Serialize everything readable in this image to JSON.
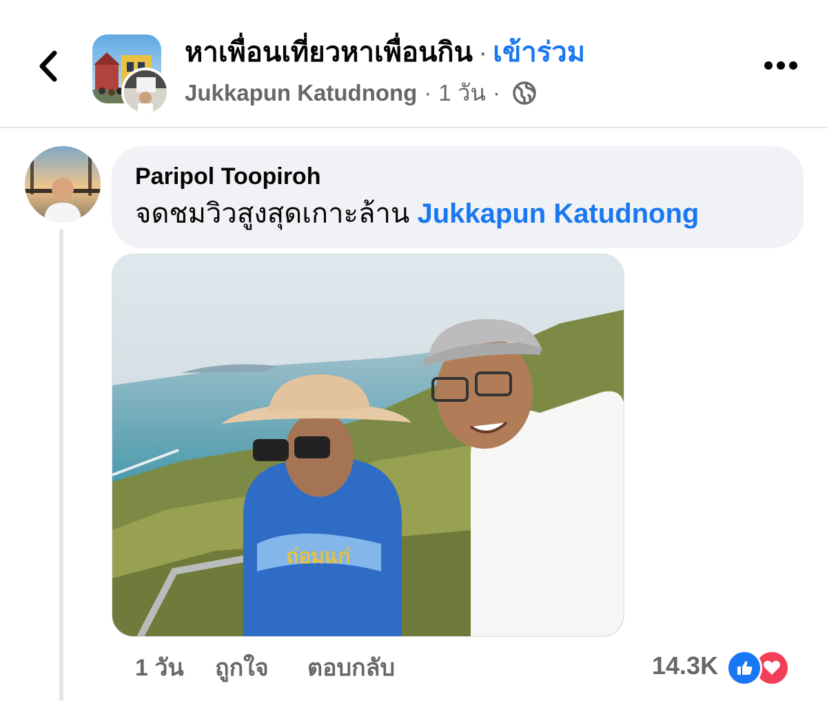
{
  "header": {
    "group_name": "หาเพื่อนเที่ยวหาเพื่อนกิน",
    "dot": "·",
    "join_label": "เข้าร่วม",
    "author": "Jukkapun Katudnong",
    "meta_sep": "·",
    "time": "1 วัน",
    "meta_sep2": "·",
    "privacy_icon": "globe-icon",
    "back_icon": "chevron-left-icon",
    "more_icon": "more-horizontal-icon"
  },
  "comment": {
    "name": "Paripol Toopiroh",
    "text": "จดชมวิวสูงสุดเกาะล้าน",
    "mention": "Jukkapun Katudnong",
    "photo_icon": "photo",
    "actions": {
      "time": "1 วัน",
      "like": "ถูกใจ",
      "reply": "ตอบกลับ"
    },
    "reactions": {
      "count": "14.3K",
      "icons": [
        "like-reaction-icon",
        "love-reaction-icon"
      ]
    }
  },
  "colors": {
    "accent": "#1877f2",
    "secondary_text": "#65676b",
    "bubble_bg": "#f0f2f5",
    "love": "#f33e58"
  }
}
